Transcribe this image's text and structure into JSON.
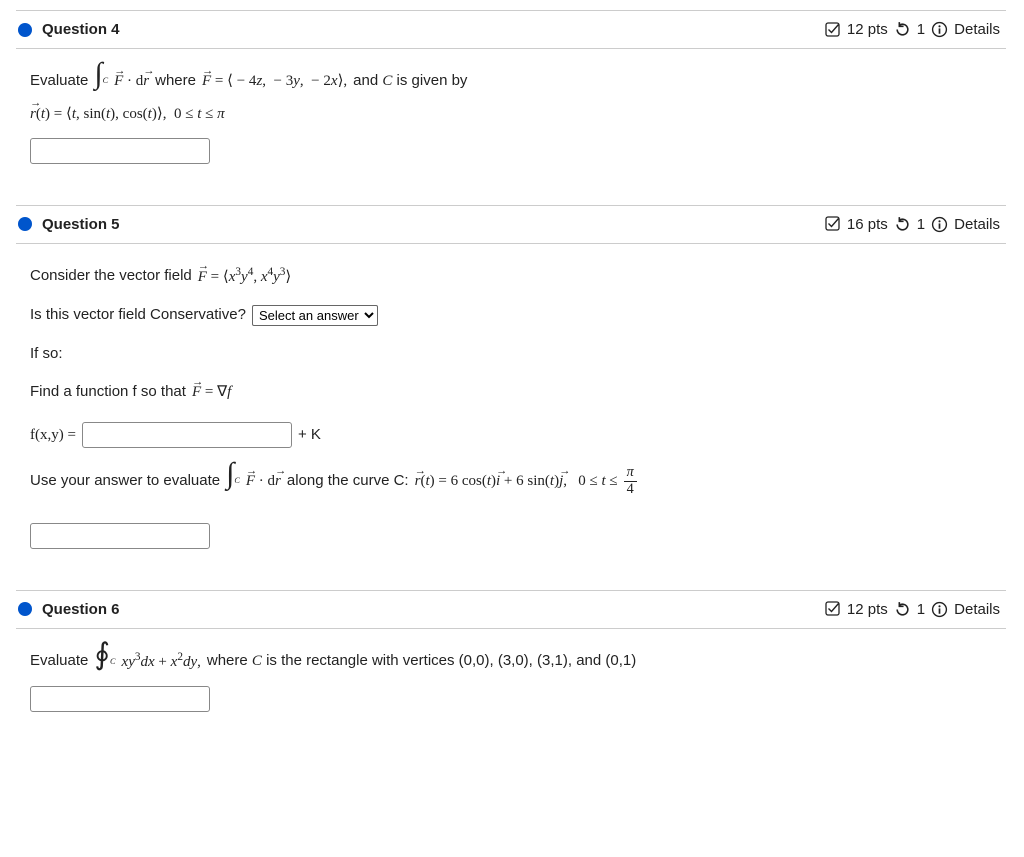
{
  "q4": {
    "title": "Question 4",
    "pts": "12 pts",
    "attempts": "1",
    "details": "Details",
    "text1a": "Evaluate",
    "integrand": "F⃗ · dr⃗",
    "text1b": "where",
    "eq1": "F⃗ = ⟨ − 4z,  − 3y,  − 2x⟩,",
    "text1c": "and C is given by",
    "eq2": "r⃗(t) = ⟨t, sin(t), cos(t)⟩,  0 ≤ t ≤ π"
  },
  "q5": {
    "title": "Question 5",
    "pts": "16 pts",
    "attempts": "1",
    "details": "Details",
    "line1a": "Consider the vector field",
    "line1b": "F⃗ = ⟨x³y⁴, x⁴y³⟩",
    "line2": "Is this vector field Conservative?",
    "select_placeholder": "Select an answer",
    "line3": "If so:",
    "line4a": "Find a function f so that",
    "line4b": "F⃗ = ∇f",
    "fxy": "f(x,y) =",
    "plusK": "+ K",
    "line6a": "Use your answer to evaluate",
    "line6b": "F⃗ · dr⃗",
    "line6c": "along the curve C:",
    "line6d": "r⃗(t) = 6 cos(t) i⃗ + 6 sin(t) j⃗,   0 ≤ t ≤",
    "frac_num": "π",
    "frac_den": "4"
  },
  "q6": {
    "title": "Question 6",
    "pts": "12 pts",
    "attempts": "1",
    "details": "Details",
    "text1": "Evaluate",
    "integrand": "xy³dx + x²dy,",
    "text2": "where C is the rectangle with vertices (0,0), (3,0), (3,1), and (0,1)"
  },
  "icons": {
    "check": "✔",
    "reset": "↺",
    "info": "ⓘ"
  }
}
